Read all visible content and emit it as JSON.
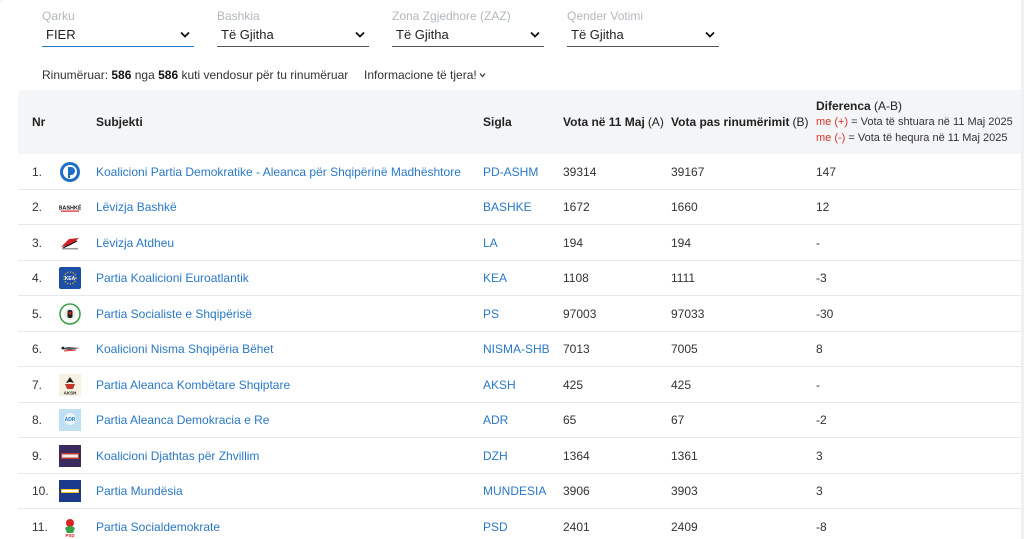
{
  "filters": [
    {
      "label": "Qarku",
      "value": "FIER"
    },
    {
      "label": "Bashkia",
      "value": "Të Gjitha"
    },
    {
      "label": "Zona Zgjedhore (ZAZ)",
      "value": "Të Gjitha"
    },
    {
      "label": "Qender Votimi",
      "value": "Të Gjitha"
    }
  ],
  "summary": {
    "prefix": "Rinumëruar:",
    "counted": "586",
    "middle": "nga",
    "total": "586",
    "suffix": "kuti vendosur për tu rinumëruar"
  },
  "more_info": "Informacione të tjera!",
  "headers": {
    "nr": "Nr",
    "subjekti": "Subjekti",
    "sigla": "Sigla",
    "vota_a": "Vota në 11 Maj",
    "vota_a_sub": "(A)",
    "vota_b": "Vota pas rinumërimit",
    "vota_b_sub": "(B)",
    "diff": "Diferenca",
    "diff_sub": "(A-B)",
    "diff_plus_prefix": "me (+)",
    "diff_plus_text": "= Vota të shtuara në 11 Maj 2025",
    "diff_minus_prefix": "me (-)",
    "diff_minus_text": "= Vota të hequra në 11 Maj 2025"
  },
  "rows": [
    {
      "nr": "1.",
      "logo": "pd-logo-icon",
      "subjekti": "Koalicioni Partia Demokratike - Aleanca për Shqipërinë Madhështore",
      "sigla": "PD-ASHM",
      "vota_a": "39314",
      "vota_b": "39167",
      "diff": "147"
    },
    {
      "nr": "2.",
      "logo": "bashke-logo-icon",
      "subjekti": "Lëvizja Bashkë",
      "sigla": "BASHKE",
      "vota_a": "1672",
      "vota_b": "1660",
      "diff": "12"
    },
    {
      "nr": "3.",
      "logo": "la-logo-icon",
      "subjekti": "Lëvizja Atdheu",
      "sigla": "LA",
      "vota_a": "194",
      "vota_b": "194",
      "diff": "-"
    },
    {
      "nr": "4.",
      "logo": "kea-logo-icon",
      "subjekti": "Partia Koalicioni Euroatlantik",
      "sigla": "KEA",
      "vota_a": "1108",
      "vota_b": "1111",
      "diff": "-3"
    },
    {
      "nr": "5.",
      "logo": "ps-logo-icon",
      "subjekti": "Partia Socialiste e Shqipërisë",
      "sigla": "PS",
      "vota_a": "97003",
      "vota_b": "97033",
      "diff": "-30"
    },
    {
      "nr": "6.",
      "logo": "nisma-logo-icon",
      "subjekti": "Koalicioni Nisma Shqipëria Bëhet",
      "sigla": "NISMA-SHB",
      "vota_a": "7013",
      "vota_b": "7005",
      "diff": "8"
    },
    {
      "nr": "7.",
      "logo": "aksh-logo-icon",
      "subjekti": "Partia Aleanca Kombëtare Shqiptare",
      "sigla": "AKSH",
      "vota_a": "425",
      "vota_b": "425",
      "diff": "-"
    },
    {
      "nr": "8.",
      "logo": "adr-logo-icon",
      "subjekti": "Partia Aleanca Demokracia e Re",
      "sigla": "ADR",
      "vota_a": "65",
      "vota_b": "67",
      "diff": "-2"
    },
    {
      "nr": "9.",
      "logo": "dzh-logo-icon",
      "subjekti": "Koalicioni Djathtas për Zhvillim",
      "sigla": "DZH",
      "vota_a": "1364",
      "vota_b": "1361",
      "diff": "3"
    },
    {
      "nr": "10.",
      "logo": "mundesia-logo-icon",
      "subjekti": "Partia Mundësia",
      "sigla": "MUNDESIA",
      "vota_a": "3906",
      "vota_b": "3903",
      "diff": "3"
    },
    {
      "nr": "11.",
      "logo": "psd-logo-icon",
      "subjekti": "Partia Socialdemokrate",
      "sigla": "PSD",
      "vota_a": "2401",
      "vota_b": "2409",
      "diff": "-8"
    }
  ]
}
